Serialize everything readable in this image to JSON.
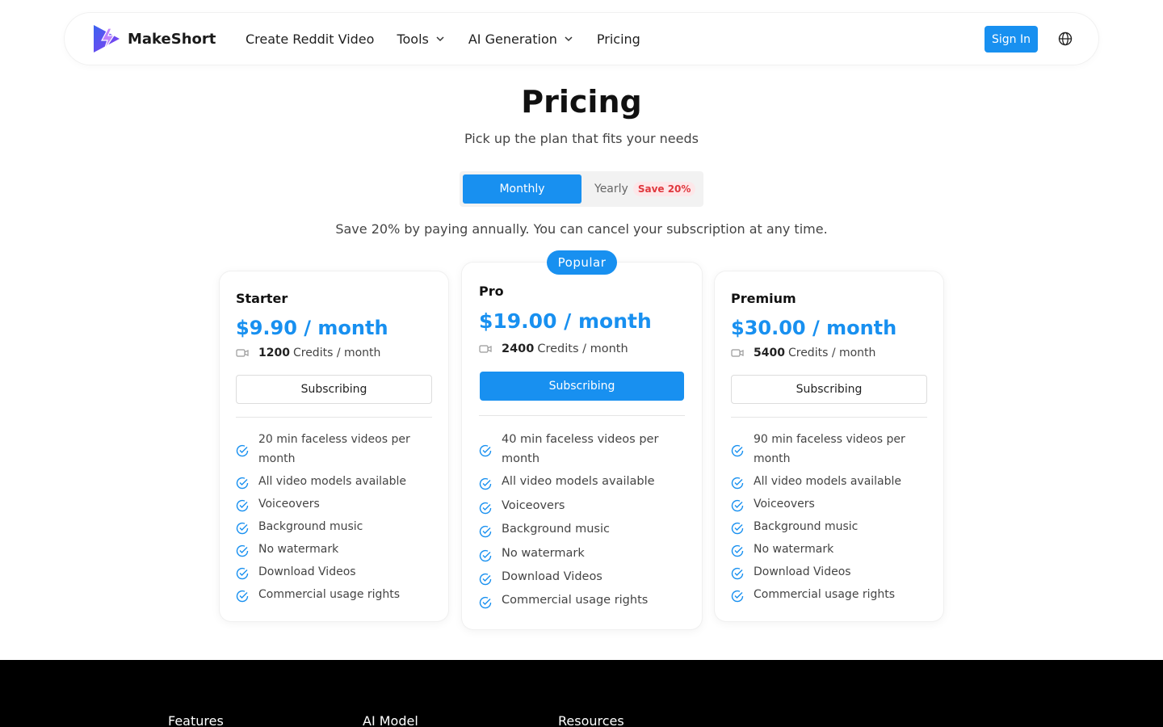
{
  "nav": {
    "brand": "MakeShort",
    "links": [
      {
        "label": "Create Reddit Video"
      },
      {
        "label": "Tools"
      },
      {
        "label": "AI Generation"
      },
      {
        "label": "Pricing"
      }
    ],
    "sign_in": "Sign In"
  },
  "header": {
    "title": "Pricing",
    "subtitle": "Pick up the plan that fits your needs"
  },
  "billing_toggle": {
    "monthly": "Monthly",
    "yearly": "Yearly",
    "save_badge": "Save 20%",
    "selected": "Monthly"
  },
  "notice": "Save 20% by paying annually. You can cancel your subscription at any time.",
  "popular_badge": "Popular",
  "plans": [
    {
      "name": "Starter",
      "price": "$9.90 / month",
      "credits_amount": "1200",
      "credits_unit": "Credits / month",
      "button": "Subscribing",
      "features": [
        "20 min faceless videos per month",
        "All video models available",
        "Voiceovers",
        "Background music",
        "No watermark",
        "Download Videos",
        "Commercial usage rights"
      ]
    },
    {
      "name": "Pro",
      "price": "$19.00 / month",
      "credits_amount": "2400",
      "credits_unit": "Credits / month",
      "button": "Subscribing",
      "features": [
        "40 min faceless videos per month",
        "All video models available",
        "Voiceovers",
        "Background music",
        "No watermark",
        "Download Videos",
        "Commercial usage rights"
      ]
    },
    {
      "name": "Premium",
      "price": "$30.00 / month",
      "credits_amount": "5400",
      "credits_unit": "Credits / month",
      "button": "Subscribing",
      "features": [
        "90 min faceless videos per month",
        "All video models available",
        "Voiceovers",
        "Background music",
        "No watermark",
        "Download Videos",
        "Commercial usage rights"
      ]
    }
  ],
  "footer": {
    "columns": [
      "Features",
      "AI Model",
      "Resources"
    ]
  },
  "colors": {
    "accent": "#1890f0",
    "badge_red": "#e0383e",
    "footer_bg": "#000000"
  },
  "icons": [
    "logo-icon",
    "chevron-down-icon",
    "globe-icon",
    "video-icon",
    "check-circle-icon"
  ]
}
